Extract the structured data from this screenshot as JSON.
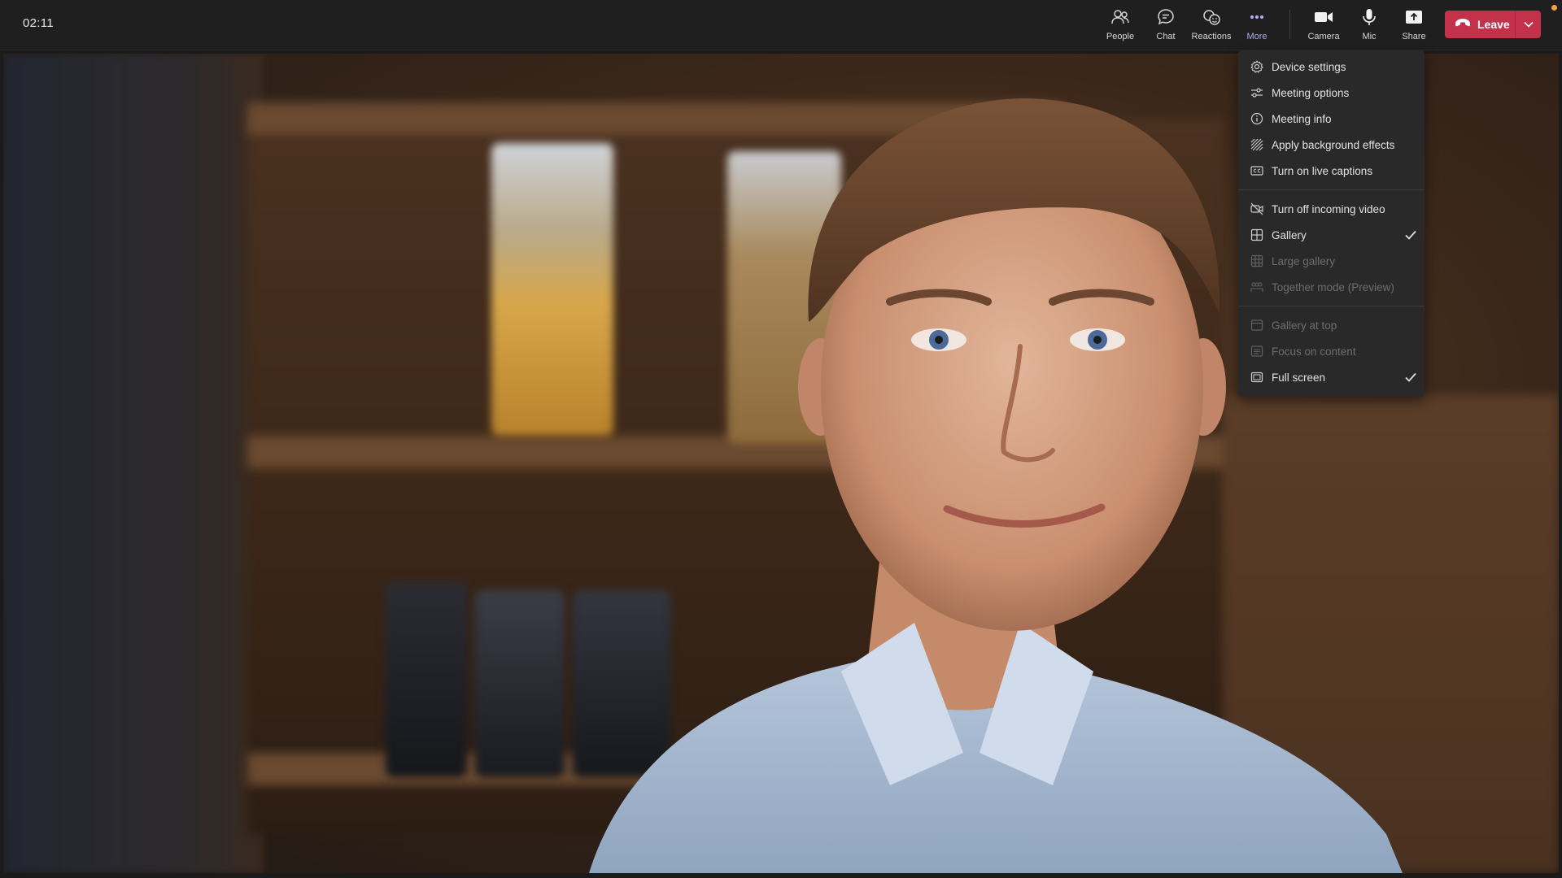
{
  "meeting": {
    "timer": "02:11"
  },
  "toolbar": {
    "people": {
      "label": "People",
      "icon": "people-icon"
    },
    "chat": {
      "label": "Chat",
      "icon": "chat-icon"
    },
    "reactions": {
      "label": "Reactions",
      "icon": "reactions-icon"
    },
    "more": {
      "label": "More",
      "icon": "more-icon",
      "active": true
    },
    "camera": {
      "label": "Camera",
      "icon": "camera-icon"
    },
    "mic": {
      "label": "Mic",
      "icon": "mic-icon"
    },
    "share": {
      "label": "Share",
      "icon": "share-icon"
    },
    "leave": {
      "label": "Leave",
      "icon": "phone-hangup-icon",
      "color": "#c4314b"
    }
  },
  "more_menu": {
    "group1": [
      {
        "label": "Device settings",
        "icon": "gear-icon",
        "enabled": true
      },
      {
        "label": "Meeting options",
        "icon": "sliders-icon",
        "enabled": true
      },
      {
        "label": "Meeting info",
        "icon": "info-icon",
        "enabled": true
      },
      {
        "label": "Apply background effects",
        "icon": "background-effects-icon",
        "enabled": true
      },
      {
        "label": "Turn on live captions",
        "icon": "captions-icon",
        "enabled": true
      }
    ],
    "group2": [
      {
        "label": "Turn off incoming video",
        "icon": "video-off-icon",
        "enabled": true
      },
      {
        "label": "Gallery",
        "icon": "gallery-icon",
        "enabled": true,
        "checked": true
      },
      {
        "label": "Large gallery",
        "icon": "large-gallery-icon",
        "enabled": false
      },
      {
        "label": "Together mode (Preview)",
        "icon": "together-mode-icon",
        "enabled": false
      }
    ],
    "group3": [
      {
        "label": "Gallery at top",
        "icon": "gallery-top-icon",
        "enabled": false
      },
      {
        "label": "Focus on content",
        "icon": "focus-content-icon",
        "enabled": false
      },
      {
        "label": "Full screen",
        "icon": "fullscreen-icon",
        "enabled": true,
        "checked": true
      }
    ]
  },
  "colors": {
    "accent": "#a9adf5",
    "leave": "#c4314b",
    "menu_bg": "#292929",
    "topbar_bg": "#1f1f1f"
  }
}
